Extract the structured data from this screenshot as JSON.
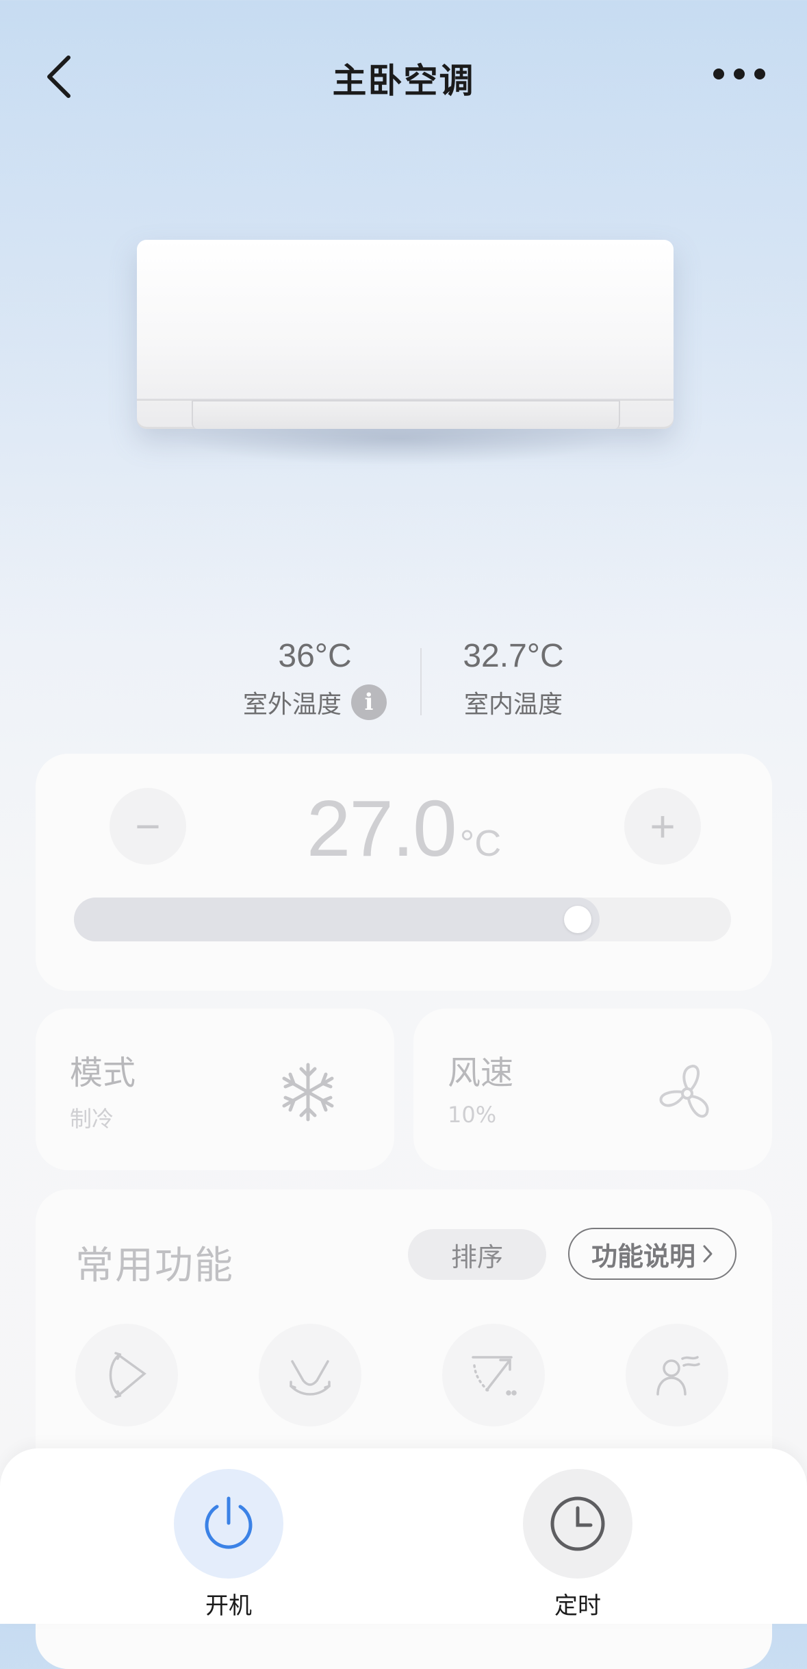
{
  "header": {
    "title": "主卧空调",
    "back_icon": "chevron-left-icon",
    "more_icon": "more-dots-icon"
  },
  "climate": {
    "outdoor": {
      "value": "36°C",
      "label": "室外温度",
      "info_icon": "info-icon",
      "info_glyph": "i"
    },
    "indoor": {
      "value": "32.7°C",
      "label": "室内温度"
    }
  },
  "temperature_control": {
    "minus_label": "−",
    "plus_label": "+",
    "set_value": "27.0",
    "unit": "°C",
    "slider_fraction": 0.8
  },
  "mode": {
    "title": "模式",
    "value": "制冷",
    "icon": "snowflake-icon"
  },
  "wind": {
    "title": "风速",
    "value": "10%",
    "icon": "fan-icon"
  },
  "functions": {
    "title": "常用功能",
    "sort_label": "排序",
    "help_label": "功能说明",
    "help_icon": "chevron-right-icon",
    "items": [
      {
        "icon": "swing-vertical-icon"
      },
      {
        "icon": "swing-horizontal-icon"
      },
      {
        "icon": "airflow-direction-icon"
      },
      {
        "icon": "wind-avoid-person-icon"
      }
    ]
  },
  "bottom_bar": {
    "power": {
      "label": "开机",
      "icon": "power-icon"
    },
    "timer": {
      "label": "定时",
      "icon": "clock-icon"
    }
  },
  "colors": {
    "accent_blue": "#3b82e6",
    "power_bg": "#e4edfb"
  }
}
